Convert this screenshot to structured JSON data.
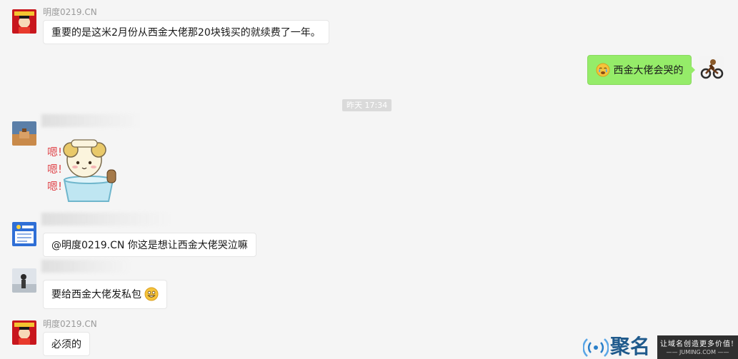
{
  "messages": [
    {
      "sender": "明度0219.CN",
      "text": "重要的是这米2月份从西金大佬那20块钱买的就续费了一年。"
    },
    {
      "text": "西金大佬会哭的",
      "emoji": "crying-face-emoji"
    },
    {
      "text": "@明度0219.CN 你这是想让西金大佬哭泣嘛"
    },
    {
      "text": "要给西金大佬发私包",
      "emoji": "grinning-face-emoji"
    },
    {
      "sender": "明度0219.CN",
      "text": "必须的"
    }
  ],
  "timestamp": "昨天 17:34",
  "sticker": {
    "text_lines": [
      "嗯!",
      "嗯!",
      "嗯!"
    ]
  },
  "watermark": {
    "brand": "聚名",
    "slogan": "让域名创造更多价值!",
    "domain": "—— JUMING.COM ——"
  },
  "colors": {
    "background": "#f5f5f5",
    "self_bubble": "#95ec69",
    "other_bubble": "#ffffff",
    "name_text": "#9a9a9a"
  }
}
